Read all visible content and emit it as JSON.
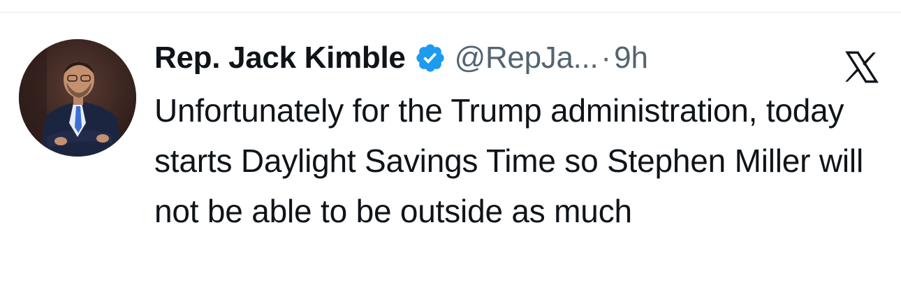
{
  "tweet": {
    "author": {
      "display_name": "Rep. Jack Kimble",
      "handle": "@RepJa...",
      "verified": true
    },
    "separator": "·",
    "time": "9h",
    "text": "Unfortunately for the Trump administration, today starts Daylight Savings Time so Stephen Miller will not be able to be outside as much"
  },
  "icons": {
    "verified": "verified-badge-icon",
    "platform": "x-logo-icon"
  },
  "colors": {
    "verified_blue": "#1d9bf0",
    "text_primary": "#0f1419",
    "text_secondary": "#536471"
  }
}
